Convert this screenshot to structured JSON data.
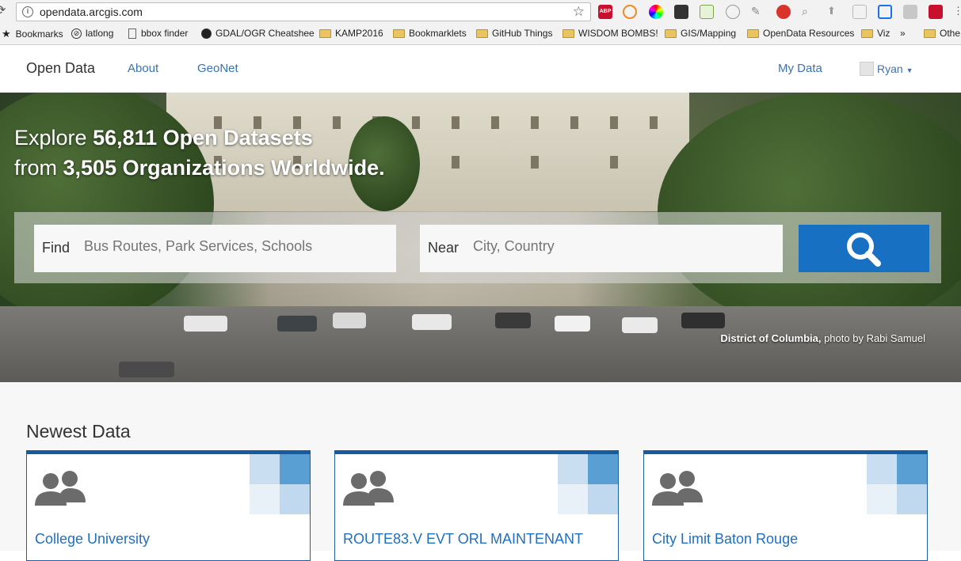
{
  "browser": {
    "url": "opendata.arcgis.com",
    "bookmarks": [
      {
        "label": "Bookmarks",
        "icon": "star-icon"
      },
      {
        "label": "latlong",
        "icon": "compass-icon"
      },
      {
        "label": "bbox finder",
        "icon": "page-icon"
      },
      {
        "label": "GDAL/OGR Cheatshee",
        "icon": "github-icon"
      },
      {
        "label": "KAMP2016",
        "icon": "folder-icon"
      },
      {
        "label": "Bookmarklets",
        "icon": "folder-icon"
      },
      {
        "label": "GitHub Things",
        "icon": "folder-icon"
      },
      {
        "label": "WISDOM BOMBS!",
        "icon": "folder-icon"
      },
      {
        "label": "GIS/Mapping",
        "icon": "folder-icon"
      },
      {
        "label": "OpenData Resources",
        "icon": "folder-icon"
      },
      {
        "label": "Viz",
        "icon": "folder-icon"
      }
    ],
    "overflow": "»",
    "other": "Othe",
    "abp_label": "ABP",
    "accent_colors": {
      "abp": "#c8102e",
      "extension_blue": "#1a73e8"
    }
  },
  "site": {
    "brand": "Open Data",
    "nav": [
      "About",
      "GeoNet"
    ],
    "my_data": "My Data",
    "user": "Ryan"
  },
  "hero": {
    "title_l1_a": "Explore ",
    "title_l1_b": "56,811 Open Datasets",
    "title_l2_a": "from ",
    "title_l2_b": "3,505 Organizations Worldwide.",
    "find_label": "Find",
    "find_placeholder": "Bus Routes, Park Services, Schools",
    "near_label": "Near",
    "near_placeholder": "City, Country",
    "credit_place": "District of Columbia,",
    "credit_rest": " photo by Rabi Samuel",
    "search_color": "#1770c2"
  },
  "newest": {
    "title": "Newest Data",
    "cards": [
      {
        "title": "College University"
      },
      {
        "title": "ROUTE83.V EVT ORL MAINTENANT"
      },
      {
        "title": "City Limit Baton Rouge"
      }
    ]
  }
}
